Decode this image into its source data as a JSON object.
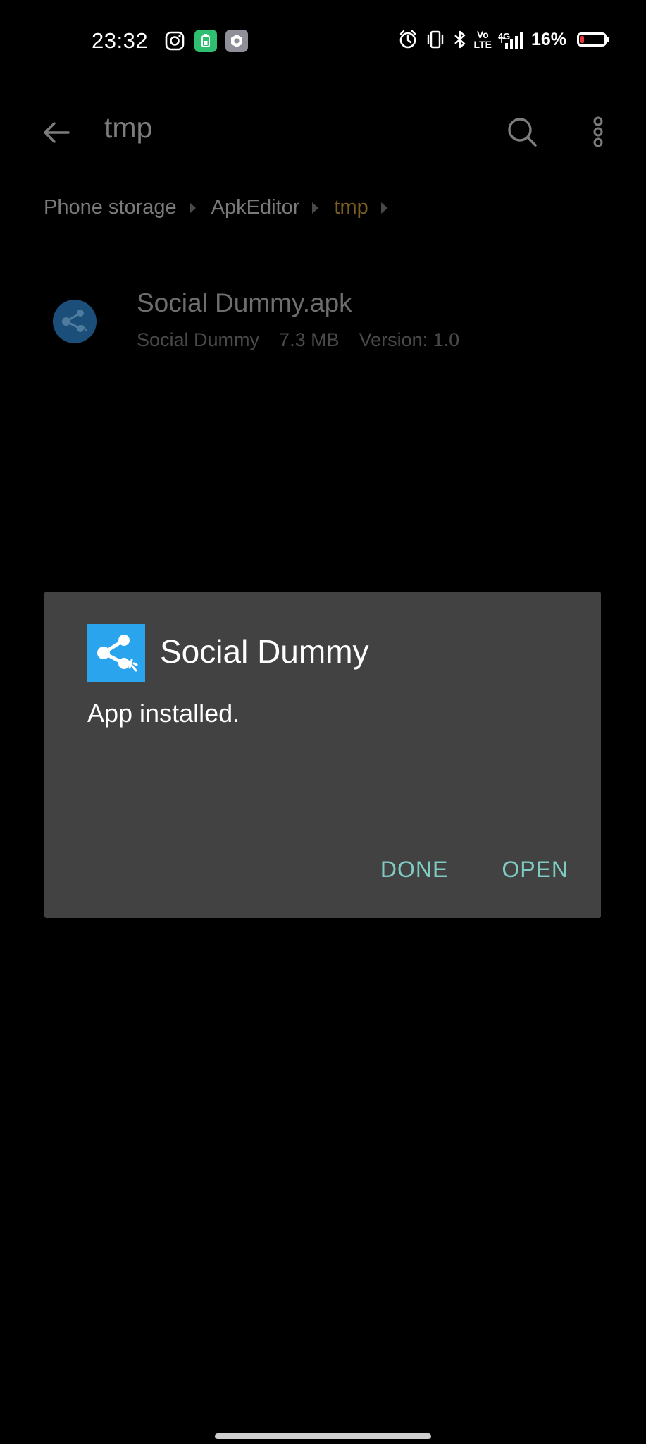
{
  "status_bar": {
    "time": "23:32",
    "battery_percent": "16%",
    "battery_level": 0.16,
    "battery_color": "#e53935",
    "network_label": "4G",
    "volte_label_top": "Vo",
    "volte_label_bottom": "LTE",
    "notification_icons": [
      "instagram-icon",
      "battery-saver-icon",
      "settings-icon"
    ],
    "system_icons": [
      "alarm-icon",
      "vibrate-icon",
      "bluetooth-icon",
      "volte-icon",
      "signal-icon"
    ]
  },
  "appbar": {
    "title": "tmp",
    "back_icon": "arrow-left-icon",
    "search_icon": "search-icon",
    "more_icon": "more-vert-icon"
  },
  "breadcrumb": {
    "items": [
      "Phone storage",
      "ApkEditor",
      "tmp"
    ],
    "active_color": "#7b5d22"
  },
  "file_list": {
    "items": [
      {
        "name": "Social Dummy.apk",
        "app_label": "Social Dummy",
        "size": "7.3 MB",
        "version": "Version: 1.0",
        "icon": "share-app-icon"
      }
    ]
  },
  "dialog": {
    "title": "Social Dummy",
    "message": "App installed.",
    "done_label": "DONE",
    "open_label": "OPEN",
    "icon": "share-app-icon",
    "icon_bg": "#2aa4ec",
    "button_color": "#7fcbc4",
    "background": "#424242"
  }
}
